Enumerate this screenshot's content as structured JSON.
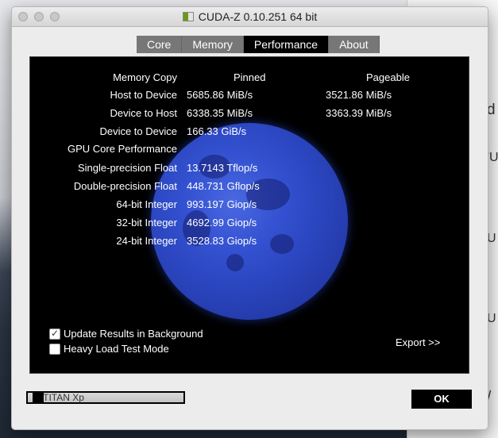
{
  "window": {
    "title": "CUDA-Z 0.10.251 64 bit"
  },
  "tabs": [
    {
      "label": "Core",
      "active": false
    },
    {
      "label": "Memory",
      "active": false
    },
    {
      "label": "Performance",
      "active": true
    },
    {
      "label": "About",
      "active": false
    }
  ],
  "performance": {
    "memory_copy_header": "Memory Copy",
    "pinned_header": "Pinned",
    "pageable_header": "Pageable",
    "rows": [
      {
        "label": "Host to Device",
        "pinned": "5685.86 MiB/s",
        "pageable": "3521.86 MiB/s"
      },
      {
        "label": "Device to Host",
        "pinned": "6338.35 MiB/s",
        "pageable": "3363.39 MiB/s"
      },
      {
        "label": "Device to Device",
        "pinned": "166.33 GiB/s",
        "pageable": ""
      },
      {
        "label": "GPU Core Performance",
        "pinned": "",
        "pageable": ""
      },
      {
        "label": "Single-precision Float",
        "pinned": "13.7143 Tflop/s",
        "pageable": ""
      },
      {
        "label": "Double-precision Float",
        "pinned": "448.731 Gflop/s",
        "pageable": ""
      },
      {
        "label": "64-bit Integer",
        "pinned": "993.197 Giop/s",
        "pageable": ""
      },
      {
        "label": "32-bit Integer",
        "pinned": "4692.99 Giop/s",
        "pageable": ""
      },
      {
        "label": "24-bit Integer",
        "pinned": "3528.83 Giop/s",
        "pageable": ""
      }
    ]
  },
  "options": {
    "update_background": {
      "label": "Update Results in Background",
      "checked": true
    },
    "heavy_load": {
      "label": "Heavy Load Test Mode",
      "checked": false
    }
  },
  "export_label": "Export >>",
  "device": {
    "selected": "0: TITAN Xp"
  },
  "ok_label": "OK",
  "colors": {
    "panel_bg": "#000000",
    "moon": "#3351d0",
    "tab_active": "#000000",
    "tab_inactive": "#777777"
  }
}
